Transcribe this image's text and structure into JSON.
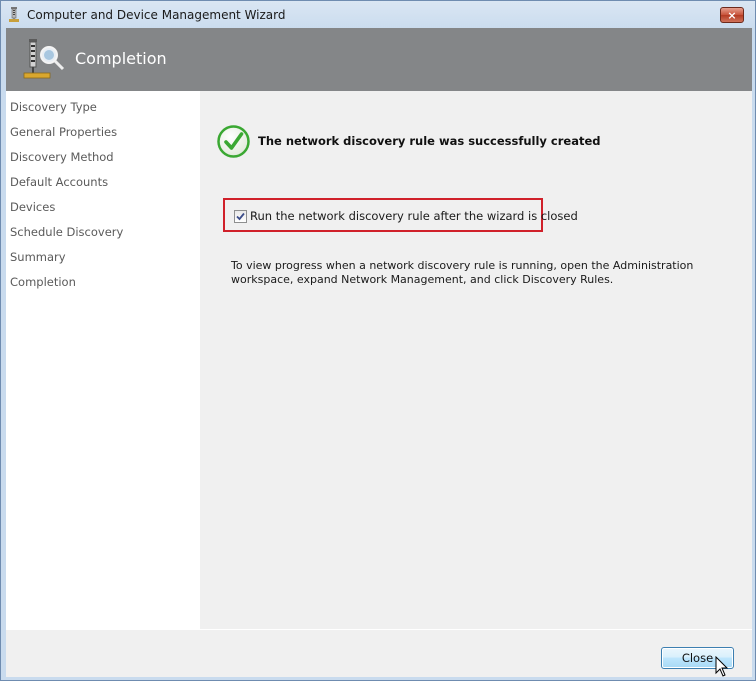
{
  "window": {
    "title": "Computer and Device Management Wizard",
    "close_glyph": "×"
  },
  "header": {
    "title": "Completion",
    "icon": "discovery-wizard-icon"
  },
  "sidebar": {
    "items": [
      {
        "label": "Discovery Type"
      },
      {
        "label": "General Properties"
      },
      {
        "label": "Discovery Method"
      },
      {
        "label": "Default Accounts"
      },
      {
        "label": "Devices"
      },
      {
        "label": "Schedule Discovery"
      },
      {
        "label": "Summary"
      },
      {
        "label": "Completion"
      }
    ]
  },
  "main": {
    "success_icon": "green-checkmark-icon",
    "success_message": "The network discovery rule was successfully created",
    "run_checkbox": {
      "label": "Run the network discovery rule after the wizard is closed",
      "checked": true
    },
    "info_text": "To view progress when a network discovery rule is running, open the Administration workspace, expand Network Management, and click Discovery Rules."
  },
  "footer": {
    "close_label": "Close"
  },
  "colors": {
    "header_bg": "#848688",
    "highlight_border": "#d0202a",
    "success_green": "#3aa832"
  }
}
